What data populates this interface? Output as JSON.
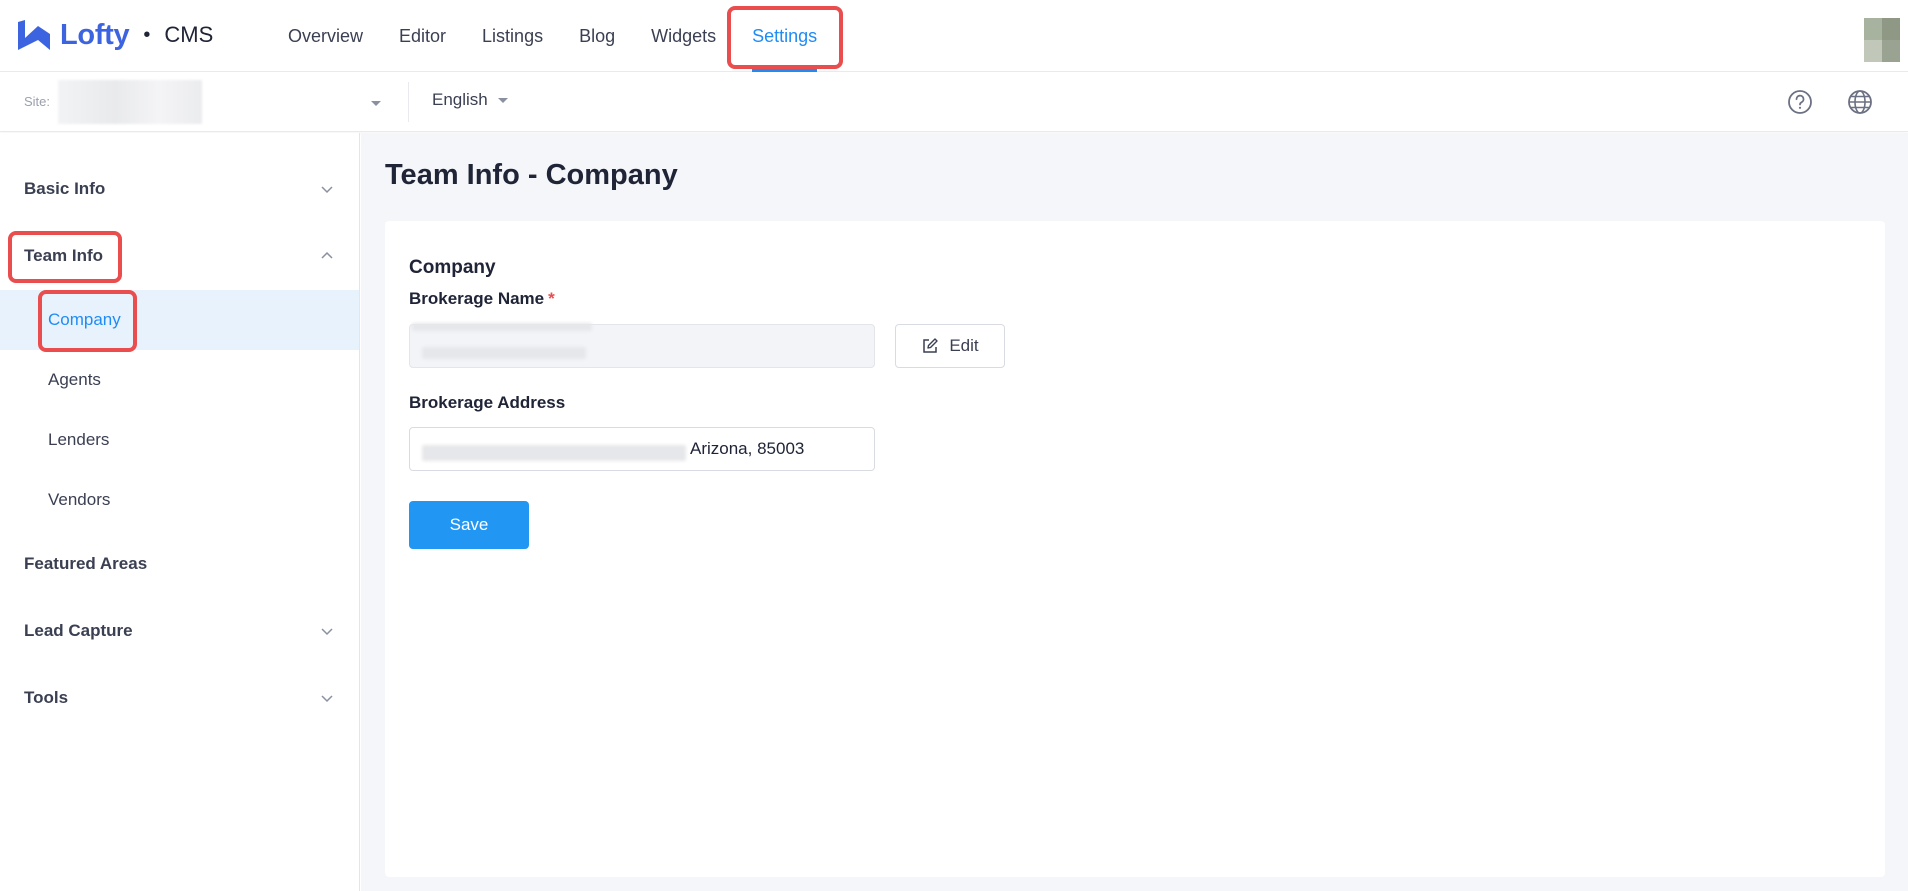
{
  "brand": {
    "name": "Lofty",
    "separator": "•",
    "product": "CMS",
    "color": "#3d64e0"
  },
  "nav": {
    "items": [
      {
        "label": "Overview"
      },
      {
        "label": "Editor"
      },
      {
        "label": "Listings"
      },
      {
        "label": "Blog"
      },
      {
        "label": "Widgets"
      },
      {
        "label": "Settings",
        "active": true
      }
    ],
    "accent_color": "#1f8cf5"
  },
  "subbar": {
    "site_label": "Site:",
    "language": "English",
    "icons": [
      "help-circle-icon",
      "globe-icon"
    ]
  },
  "sidebar": {
    "groups": [
      {
        "label": "Basic Info",
        "expanded": false,
        "icon": "chevron-down-icon"
      },
      {
        "label": "Team Info",
        "expanded": true,
        "icon": "chevron-up-icon",
        "children": [
          {
            "label": "Company",
            "active": true
          },
          {
            "label": "Agents"
          },
          {
            "label": "Lenders"
          },
          {
            "label": "Vendors"
          }
        ]
      },
      {
        "label": "Featured Areas"
      },
      {
        "label": "Lead Capture",
        "expanded": false,
        "icon": "chevron-down-icon"
      },
      {
        "label": "Tools",
        "expanded": false,
        "icon": "chevron-down-icon"
      }
    ]
  },
  "main": {
    "title": "Team Info - Company",
    "section_title": "Company",
    "brokerage_name": {
      "label": "Brokerage Name",
      "required_mark": "*",
      "edit_label": "Edit"
    },
    "brokerage_address": {
      "label": "Brokerage Address",
      "value": "Arizona, 85003"
    },
    "save_label": "Save"
  },
  "colors": {
    "highlight": "#ea4d4d",
    "primary_button": "#2196f3"
  }
}
